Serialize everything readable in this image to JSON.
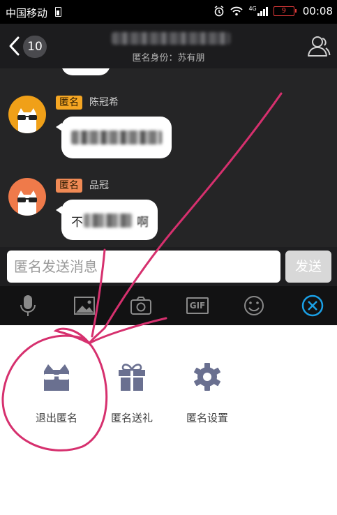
{
  "status_bar": {
    "carrier": "中国移动",
    "signal_label": "4G",
    "battery": "9",
    "time": "00:08"
  },
  "header": {
    "back_count": "10",
    "subtitle": "匿名身份：苏有朋"
  },
  "messages": [
    {
      "tag": "匿名",
      "name": "陈冠希"
    },
    {
      "tag": "匿名",
      "name": "品冠",
      "text_start": "不",
      "text_end": "啊"
    }
  ],
  "input": {
    "placeholder": "匿名发送消息",
    "send_label": "发送"
  },
  "toolbar": {
    "icons": [
      "microphone-icon",
      "image-icon",
      "camera-icon",
      "gif-icon",
      "emoji-icon",
      "close-circle-icon"
    ],
    "gif_label": "GIF"
  },
  "panel": {
    "items": [
      {
        "label": "退出匿名",
        "icon": "anonymous-cat-icon"
      },
      {
        "label": "匿名送礼",
        "icon": "gift-icon"
      },
      {
        "label": "匿名设置",
        "icon": "gear-icon"
      }
    ]
  },
  "colors": {
    "accent": "#1aa0e6",
    "tag_bg": "#f5a623",
    "panel_icon": "#6a7090",
    "annotation": "#d6306e"
  }
}
